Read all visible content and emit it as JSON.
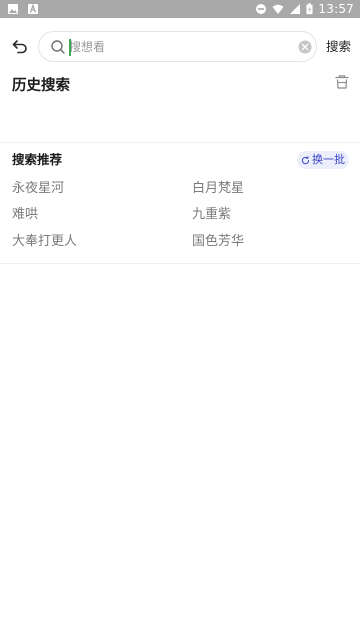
{
  "status_bar": {
    "left_icons": [
      "image-icon",
      "a-letter-icon"
    ],
    "right_icons": [
      "do-not-disturb-icon",
      "wifi-icon",
      "signal-icon",
      "battery-icon"
    ],
    "time": "13:57"
  },
  "header": {
    "back_icon": "back-arrow-icon",
    "search_placeholder": "搜想看",
    "search_value": "",
    "search_button": "搜索"
  },
  "history": {
    "title": "历史搜索",
    "clear_icon": "trash-icon",
    "items": []
  },
  "recommendations": {
    "title": "搜索推荐",
    "refresh_label": "换一批",
    "items": [
      "永夜星河",
      "白月梵星",
      "难哄",
      "九重紫",
      "大奉打更人",
      "国色芳华"
    ]
  },
  "colors": {
    "status_bar": "#a8a8a8",
    "caret": "#3aa757",
    "pill_bg": "#eceefc",
    "pill_text": "#3a46c6",
    "item_text": "#7b7b7b"
  }
}
